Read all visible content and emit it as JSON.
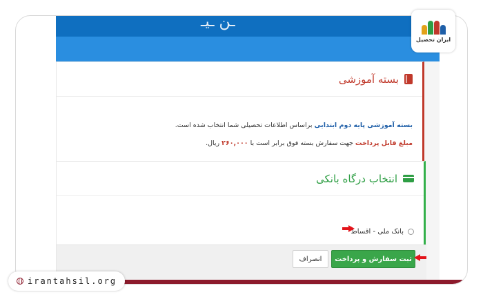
{
  "header": {
    "script_text": "ـن ـیـ"
  },
  "package_panel": {
    "title": "بسته آموزشی",
    "line1_highlight": "بسته آموزشی پایه دوم ابتدایی",
    "line1_text": " براساس اطلاعات تحصیلی شما انتخاب شده است.",
    "line2_highlight": "مبلغ قابل پرداخت",
    "line2_text": " جهت سفارش بسته فوق برابر است با ",
    "line2_amount": "۲۶۰,۰۰۰",
    "line2_unit": " ریال."
  },
  "gateway_panel": {
    "title": "انتخاب درگاه بانکی",
    "option_label": "بانک ملی - اقساط",
    "submit_label": "ثبت سفارش و پرداخت",
    "cancel_label": "انصراف"
  },
  "logo": {
    "text": "ایران تحصیل"
  },
  "site": {
    "url": "irantahsil.org"
  },
  "colors": {
    "header_blue": "#0f6fc0",
    "nav_blue": "#2a8ee0",
    "accent_red": "#c0392b",
    "accent_green": "#2e9e44",
    "pay_button": "#3aa64a",
    "bottom_bar": "#8c1b2c",
    "arrow_red": "#e3141b"
  },
  "icons": {
    "package": "book-icon",
    "gateway": "card-icon",
    "site": "globe-icon"
  }
}
